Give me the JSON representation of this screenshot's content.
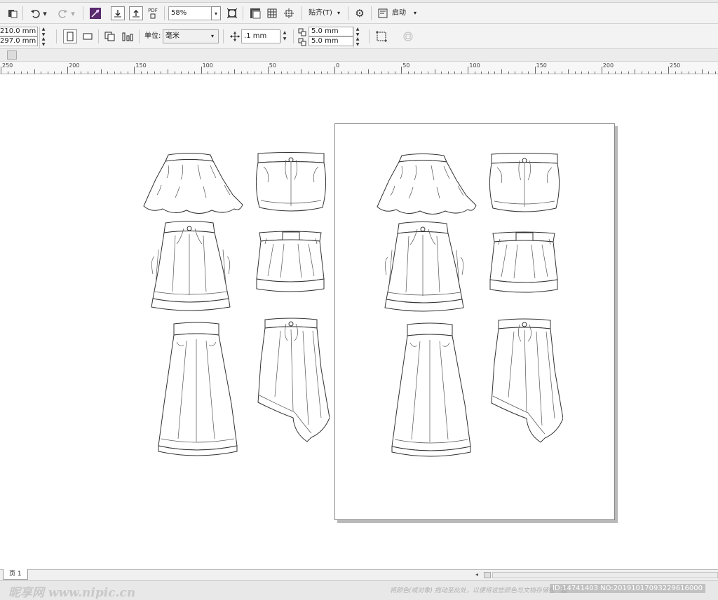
{
  "toolbar1": {
    "zoom_value": "58%",
    "snap_label": "贴齐(T)",
    "launch_label": "启动",
    "pdf_label": "PDF"
  },
  "toolbar2": {
    "width_value": "210.0 mm",
    "height_value": "297.0 mm",
    "unit_label": "单位:",
    "unit_value": "毫米",
    "nudge_value": ".1 mm",
    "dup_x_value": "5.0 mm",
    "dup_y_value": "5.0 mm"
  },
  "ruler": {
    "ticks": [
      "250",
      "200",
      "150",
      "100",
      "50",
      "0",
      "50",
      "100",
      "150",
      "200",
      "250"
    ]
  },
  "page_tabs": {
    "page1_label": "页 1"
  },
  "status": {
    "hint": "将颜色(或对象) 拖动至此处，以便将这些颜色与文档存储在一起",
    "watermark_left": "昵享网 www.nipic.cn",
    "watermark_right": "ID:14741403 NO:20191017093229616000"
  },
  "icons": [
    "new-doc-icon",
    "undo-icon",
    "redo-icon",
    "corel-launcher-icon",
    "import-icon",
    "export-icon",
    "pdf-export-icon",
    "full-screen-icon",
    "show-rulers-icon",
    "show-grid-icon",
    "show-guidelines-icon",
    "settings-icon",
    "launch-icon",
    "portrait-icon",
    "landscape-icon",
    "all-pages-icon",
    "current-page-icon",
    "nudge-icon",
    "treat-as-filled-icon"
  ]
}
